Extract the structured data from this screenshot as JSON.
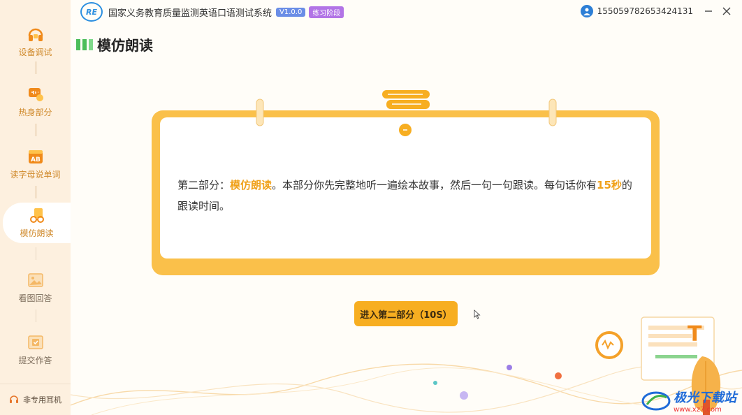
{
  "app": {
    "logo": "RE",
    "title": "国家义务教育质量监测英语口语测试系统",
    "version": "V1.0.0",
    "stage": "练习阶段",
    "user_id": "155059782653424131"
  },
  "sidebar": {
    "items": [
      {
        "label": "设备调试",
        "icon": "headphones-icon"
      },
      {
        "label": "热身部分",
        "icon": "warmup-icon"
      },
      {
        "label": "读字母说单词",
        "icon": "letters-icon"
      },
      {
        "label": "模仿朗读",
        "icon": "reading-icon"
      },
      {
        "label": "看图回答",
        "icon": "picture-icon"
      },
      {
        "label": "提交作答",
        "icon": "submit-icon"
      }
    ],
    "footer": "非专用耳机"
  },
  "section": {
    "title": "模仿朗读"
  },
  "instruction": {
    "prefix": "第二部分：",
    "highlight1": "模仿朗读",
    "middle": "。本部分你先完整地听一遍绘本故事，然后一句一句跟读。每句话你有",
    "highlight2": "15秒",
    "suffix": "的跟读时间。"
  },
  "cta": {
    "label": "进入第二部分（10S）"
  },
  "watermark": {
    "title": "极光下载站",
    "url": "www.xz7.com"
  },
  "colors": {
    "accent": "#f7ae21",
    "sidebar": "#fdf0df",
    "green": "#4cbe5a"
  }
}
